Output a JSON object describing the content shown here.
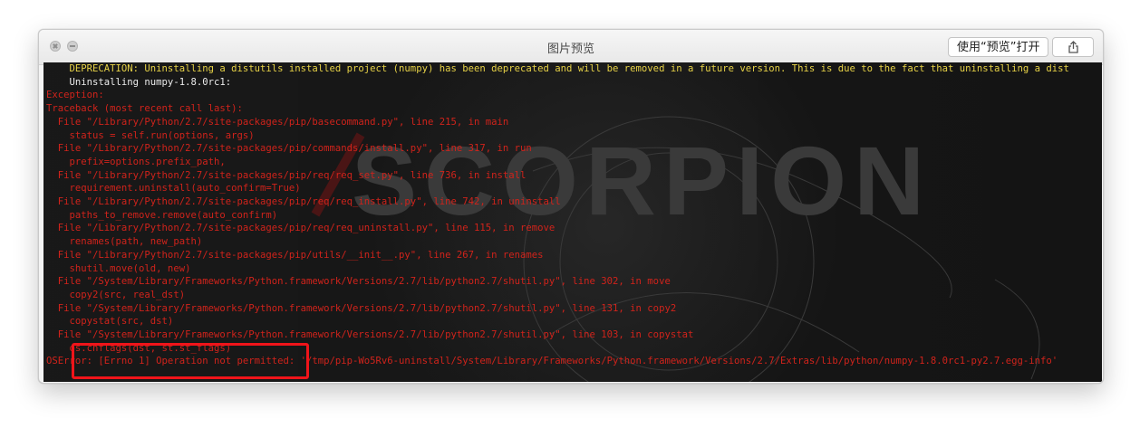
{
  "window": {
    "title": "图片预览",
    "open_with_label": "使用“预览”打开"
  },
  "terminal": {
    "background_watermark": "SCORPION",
    "lines": [
      {
        "t": "    DEPRECATION: Uninstalling a distutils installed project (numpy) has been deprecated and will be removed in a future version. This is due to the fact that uninstalling a dist",
        "c": "y"
      },
      {
        "t": "    Uninstalling numpy-1.8.0rc1:",
        "c": "w"
      },
      {
        "t": "Exception:",
        "c": "r"
      },
      {
        "t": "Traceback (most recent call last):",
        "c": "r"
      },
      {
        "t": "  File \"/Library/Python/2.7/site-packages/pip/basecommand.py\", line 215, in main",
        "c": "r"
      },
      {
        "t": "    status = self.run(options, args)",
        "c": "r"
      },
      {
        "t": "  File \"/Library/Python/2.7/site-packages/pip/commands/install.py\", line 317, in run",
        "c": "r"
      },
      {
        "t": "    prefix=options.prefix_path,",
        "c": "r"
      },
      {
        "t": "  File \"/Library/Python/2.7/site-packages/pip/req/req_set.py\", line 736, in install",
        "c": "r"
      },
      {
        "t": "    requirement.uninstall(auto_confirm=True)",
        "c": "r"
      },
      {
        "t": "  File \"/Library/Python/2.7/site-packages/pip/req/req_install.py\", line 742, in uninstall",
        "c": "r"
      },
      {
        "t": "    paths_to_remove.remove(auto_confirm)",
        "c": "r"
      },
      {
        "t": "  File \"/Library/Python/2.7/site-packages/pip/req/req_uninstall.py\", line 115, in remove",
        "c": "r"
      },
      {
        "t": "    renames(path, new_path)",
        "c": "r"
      },
      {
        "t": "  File \"/Library/Python/2.7/site-packages/pip/utils/__init__.py\", line 267, in renames",
        "c": "r"
      },
      {
        "t": "    shutil.move(old, new)",
        "c": "r"
      },
      {
        "t": "  File \"/System/Library/Frameworks/Python.framework/Versions/2.7/lib/python2.7/shutil.py\", line 302, in move",
        "c": "r"
      },
      {
        "t": "    copy2(src, real_dst)",
        "c": "r"
      },
      {
        "t": "  File \"/System/Library/Frameworks/Python.framework/Versions/2.7/lib/python2.7/shutil.py\", line 131, in copy2",
        "c": "r"
      },
      {
        "t": "    copystat(src, dst)",
        "c": "r"
      },
      {
        "t": "  File \"/System/Library/Frameworks/Python.framework/Versions/2.7/lib/python2.7/shutil.py\", line 103, in copystat",
        "c": "r"
      },
      {
        "t": "    os.chflags(dst, st.st_flags)",
        "c": "r"
      },
      {
        "t": "OSError: [Errno 1] Operation not permitted: '/tmp/pip-Wo5Rv6-uninstall/System/Library/Frameworks/Python.framework/Versions/2.7/Extras/lib/python/numpy-1.8.0rc1-py2.7.egg-info'",
        "c": "r"
      }
    ]
  },
  "colors": {
    "error_red": "#d0231b",
    "warning_yellow": "#e7d247",
    "highlight_box": "#f0141a",
    "terminal_bg": "#141414"
  },
  "icons": {
    "close": "close-icon",
    "minimize": "minimize-icon",
    "share": "share-icon"
  }
}
